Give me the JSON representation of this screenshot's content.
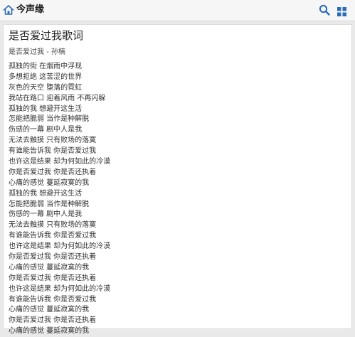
{
  "header": {
    "site_title": "今声缘",
    "home_icon": "home-icon",
    "search_icon": "search-icon",
    "grid_icon": "grid-icon",
    "accent_color": "#2b6cb8"
  },
  "article": {
    "title": "是否爱过我歌词",
    "subtitle": "是否爱过我 - 孙楠",
    "lyrics": [
      "孤独的街 在烟雨中浮现",
      "多想拒绝 这苦涩的世界",
      "灰色的天空 堕落的霓虹",
      "我站在路口 迎着风雨 不再闪躲",
      "孤独的我 想避开这生活",
      "怎能把脆弱 当作是种解脱",
      "伤感的一幕 剧中人是我",
      "无法去触摸 只有败场的落寞",
      "有谁能告诉我 你是否爱过我",
      "也许这是结果 却为何如此的冷漠",
      "你是否爱过我 你是否还执着",
      "心痛的感觉 蔓延寂寞的我",
      "孤独的我 想避开这生活",
      "怎能把脆弱 当作是种解脱",
      "伤感的一幕 剧中人是我",
      "无法去触摸 只有败场的落寞",
      "有谁能告诉我 你是否爱过我",
      "也许这是结果 却为何如此的冷漠",
      "你是否爱过我 你是否还执着",
      "心痛的感觉 蔓延寂寞的我",
      "你是否爱过我 你是否还执着",
      "也许这是结果 却为何如此的冷漠",
      "有谁能告诉我 你是否爱过我",
      "心痛的感觉 蔓延寂寞的我",
      "你是否爱过我 你是否还执着",
      "心痛的感觉 蔓延寂寞的我"
    ]
  }
}
